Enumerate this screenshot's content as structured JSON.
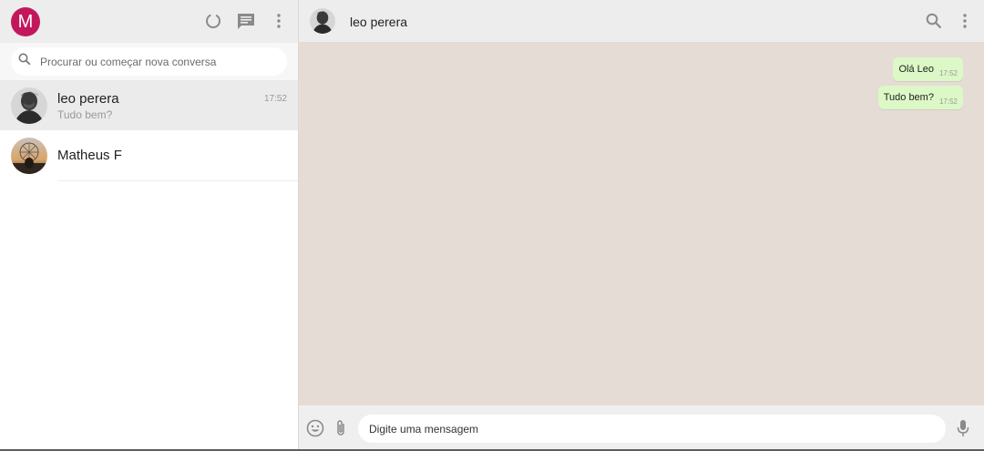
{
  "sidebar": {
    "user_initial": "M",
    "user_avatar_color": "#c2185b",
    "icons": [
      "status-icon",
      "new-chat-icon",
      "menu-icon"
    ],
    "search_placeholder": "Procurar ou começar nova conversa",
    "chats": [
      {
        "name": "leo perera",
        "preview": "Tudo bem?",
        "time": "17:52",
        "active": true
      },
      {
        "name": "Matheus F",
        "preview": "",
        "time": "",
        "active": false
      }
    ]
  },
  "conversation": {
    "contact_name": "leo perera",
    "icons": [
      "search-icon",
      "menu-icon"
    ],
    "background_color": "#e5ddd5",
    "bubble_color": "#dcf8c6",
    "messages": [
      {
        "text": "Olá Leo",
        "time": "17:52",
        "outgoing": true
      },
      {
        "text": "Tudo bem?",
        "time": "17:52",
        "outgoing": true
      }
    ]
  },
  "composer": {
    "placeholder": "Digite uma mensagem",
    "icons": [
      "emoji-icon",
      "attach-icon",
      "microphone-icon"
    ]
  }
}
